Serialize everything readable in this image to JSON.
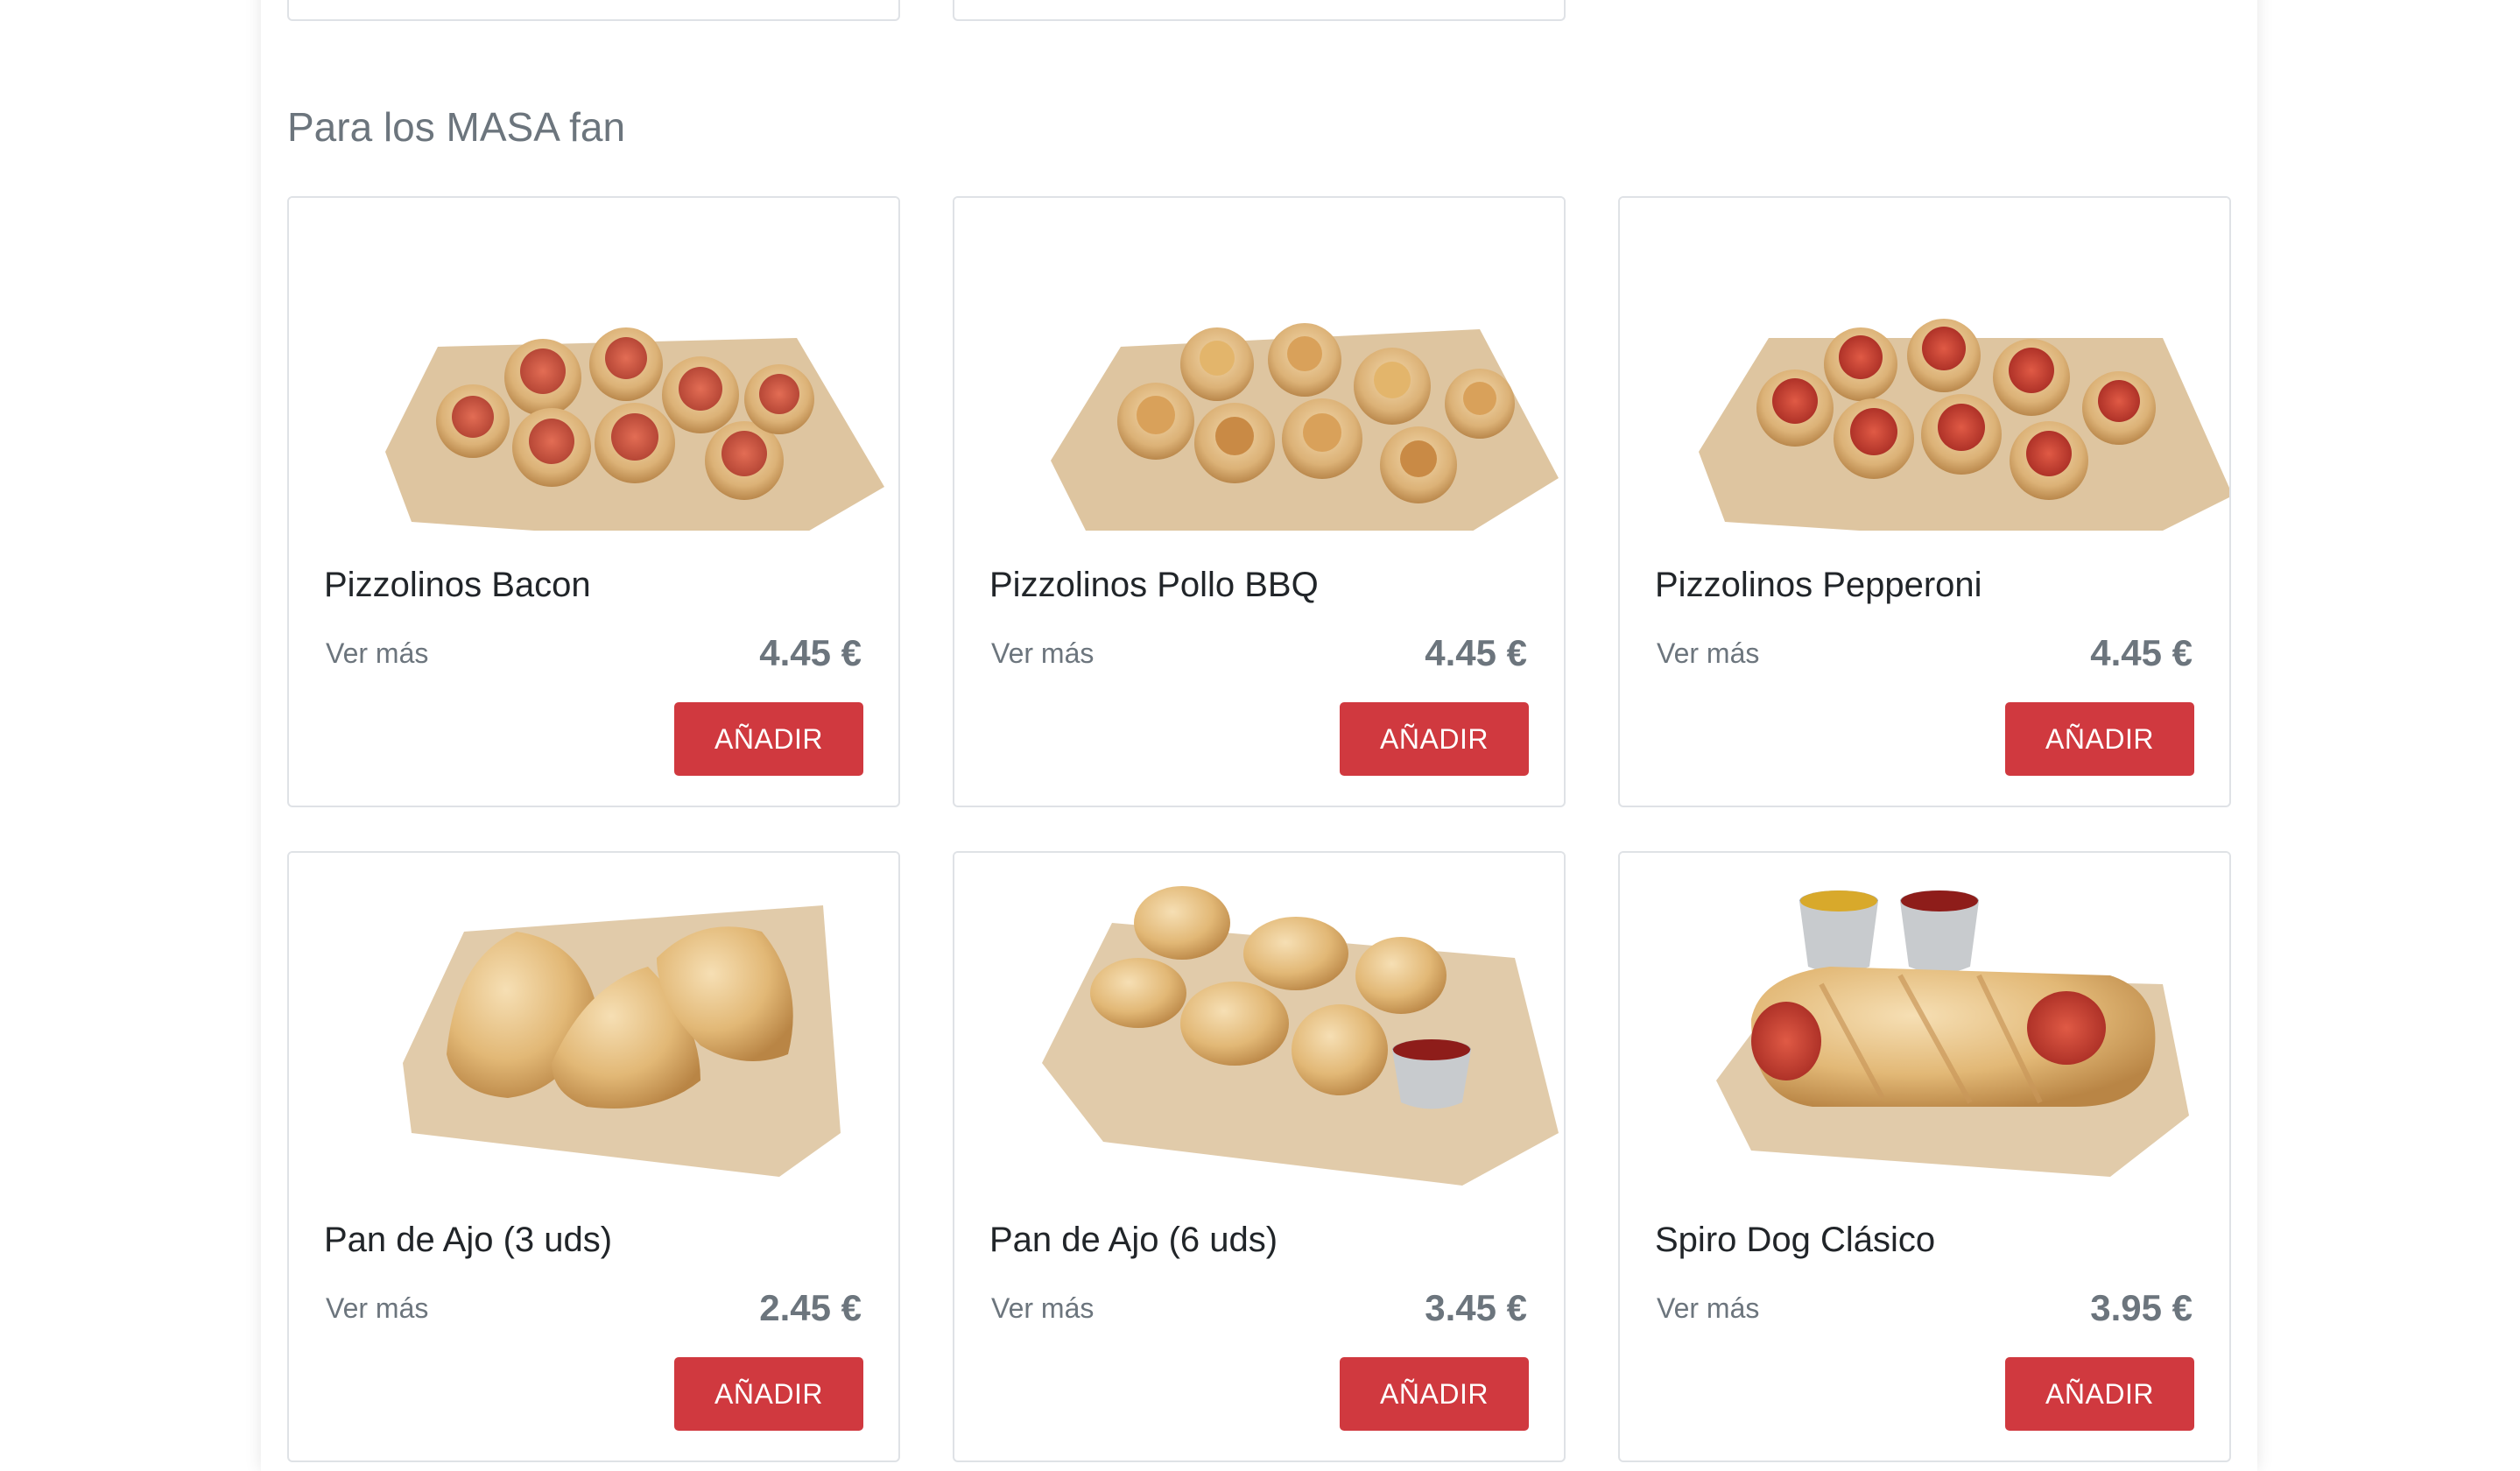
{
  "section": {
    "title": "Para los MASA fan"
  },
  "products": [
    {
      "name": "Pizzolinos Bacon",
      "more": "Ver más",
      "price": "4.45 €",
      "button": "AÑADIR",
      "image_icon": "pizzolinos-bacon-photo"
    },
    {
      "name": "Pizzolinos Pollo BBQ",
      "more": "Ver más",
      "price": "4.45 €",
      "button": "AÑADIR",
      "image_icon": "pizzolinos-pollo-bbq-photo"
    },
    {
      "name": "Pizzolinos Pepperoni",
      "more": "Ver más",
      "price": "4.45 €",
      "button": "AÑADIR",
      "image_icon": "pizzolinos-pepperoni-photo"
    },
    {
      "name": "Pan de Ajo (3 uds)",
      "more": "Ver más",
      "price": "2.45 €",
      "button": "AÑADIR",
      "image_icon": "pan-de-ajo-3-photo"
    },
    {
      "name": "Pan de Ajo (6 uds)",
      "more": "Ver más",
      "price": "3.45 €",
      "button": "AÑADIR",
      "image_icon": "pan-de-ajo-6-photo"
    },
    {
      "name": "Spiro Dog Clásico",
      "more": "Ver más",
      "price": "3.95 €",
      "button": "AÑADIR",
      "image_icon": "spiro-dog-photo"
    }
  ],
  "colors": {
    "accent": "#d0393f",
    "muted_text": "#6c757d",
    "border": "#dfe2e6"
  }
}
